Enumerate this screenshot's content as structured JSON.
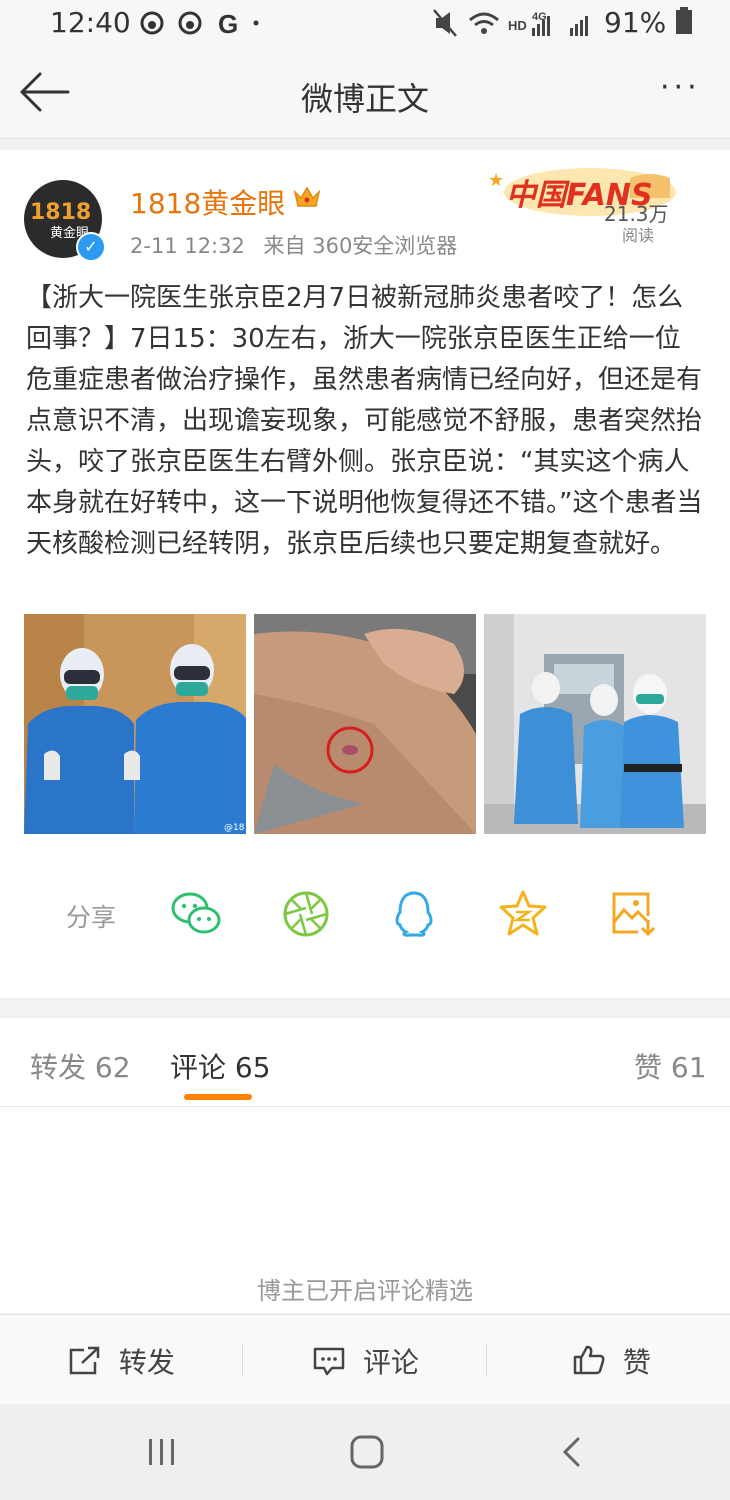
{
  "status_bar": {
    "time": "12:40",
    "left_icons": [
      "weibo-icon",
      "weibo-icon",
      "google-icon",
      "dot-icon"
    ],
    "network_label": "HD 4G",
    "battery": "91%"
  },
  "header": {
    "title": "微博正文",
    "more": "···"
  },
  "post": {
    "author": "1818黄金眼",
    "avatar_text": "1818",
    "avatar_subtext": "黄金眼",
    "timestamp": "2-11 12:32",
    "source": "来自 360安全浏览器",
    "badge": {
      "text": "中国FANS",
      "count": "21.3万",
      "label": "阅读"
    },
    "content": "【浙大一院医生张京臣2月7日被新冠肺炎患者咬了！怎么回事？】7日15：30左右，浙大一院张京臣医生正给一位危重症患者做治疗操作，虽然患者病情已经向好，但还是有点意识不清，出现谵妄现象，可能感觉不舒服，患者突然抬头，咬了张京臣医生右臂外侧。张京臣说：“其实这个病人本身就在好转中，这一下说明他恢复得还不错。”这个患者当天核酸检测已经转阴，张京臣后续也只要定期复查就好。",
    "photos": [
      "two-medical-workers-photo",
      "arm-bite-photo",
      "medical-team-photo"
    ],
    "share_label": "分享",
    "share_icons": [
      "wechat-icon",
      "moments-icon",
      "qq-icon",
      "qzone-icon",
      "save-image-icon"
    ]
  },
  "tabs": [
    {
      "label": "转发 62"
    },
    {
      "label": "评论 65"
    },
    {
      "label": "赞 61"
    }
  ],
  "comments_note": "博主已开启评论精选",
  "actions": [
    {
      "label": "转发",
      "icon": "repost-icon"
    },
    {
      "label": "评论",
      "icon": "comment-icon"
    },
    {
      "label": "赞",
      "icon": "like-icon"
    }
  ],
  "colors": {
    "accent": "#ff8200",
    "username": "#e8740c",
    "verified": "#2a9bf0"
  }
}
